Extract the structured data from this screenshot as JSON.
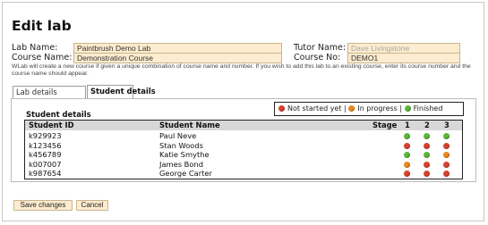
{
  "page": {
    "title": "Edit lab"
  },
  "form": {
    "lab_name_label": "Lab Name:",
    "lab_name_value": "Paintbrush Demo Lab",
    "course_name_label": "Course Name:",
    "course_name_value": "Demonstration Course",
    "tutor_name_label": "Tutor Name:",
    "tutor_name_value": "Dave Livingstone",
    "course_no_label": "Course No:",
    "course_no_value": "DEMO1",
    "note": "WLab will create a new course if given a unique combination of course name and number. If you wish to add this lab to an existing course, enter its course number and the course name should appear."
  },
  "tabs": [
    {
      "label": "Lab details",
      "active": false
    },
    {
      "label": "Student details",
      "active": true
    }
  ],
  "student_details": {
    "title": "Student details",
    "legend": {
      "not_started": "Not started yet",
      "sep1": "|",
      "in_progress": "In progress",
      "sep2": "|",
      "finished": "Finished"
    },
    "columns": {
      "id": "Student ID",
      "name": "Student Name",
      "stage": "Stage",
      "s1": "1",
      "s2": "2",
      "s3": "3"
    },
    "rows": [
      {
        "id": "k929923",
        "name": "Paul Neve",
        "stages": [
          "finished",
          "finished",
          "finished"
        ]
      },
      {
        "id": "k123456",
        "name": "Stan Woods",
        "stages": [
          "not_started",
          "not_started",
          "not_started"
        ]
      },
      {
        "id": "k456789",
        "name": "Katie Smythe",
        "stages": [
          "finished",
          "finished",
          "in_progress"
        ]
      },
      {
        "id": "k007007",
        "name": "James Bond",
        "stages": [
          "in_progress",
          "not_started",
          "not_started"
        ]
      },
      {
        "id": "k987654",
        "name": "George Carter",
        "stages": [
          "not_started",
          "not_started",
          "not_started"
        ]
      }
    ]
  },
  "status_colors": {
    "not_started": "#d9432e",
    "in_progress": "#ea8a1e",
    "finished": "#5cb83a"
  },
  "buttons": {
    "save": "Save changes",
    "cancel": "Cancel"
  }
}
